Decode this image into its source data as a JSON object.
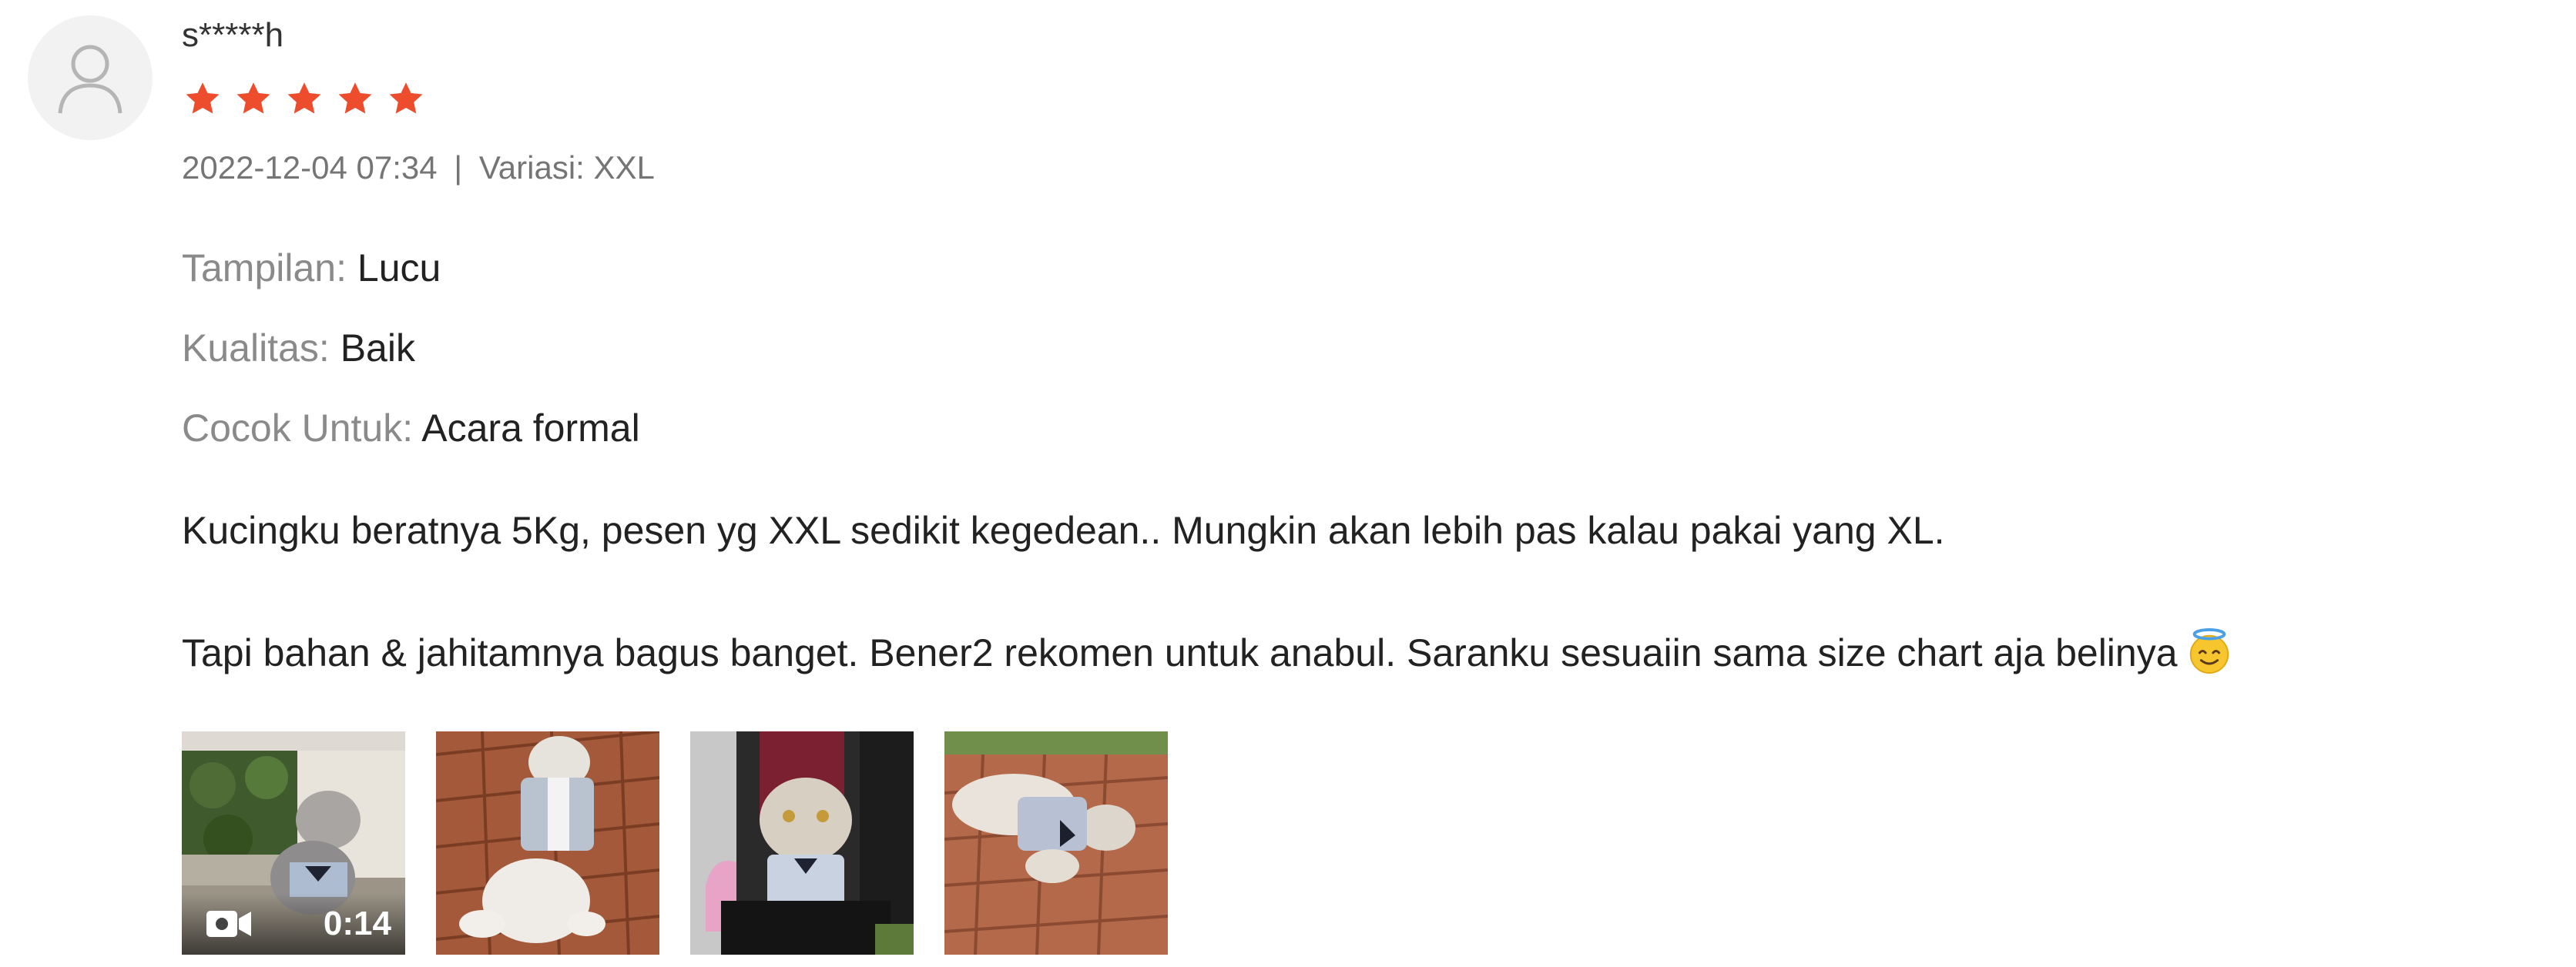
{
  "review": {
    "username": "s*****h",
    "rating": 5,
    "max_rating": 5,
    "star_color": "#ee4d2d",
    "date": "2022-12-04 07:34",
    "separator": "|",
    "variation_label": "Variasi:",
    "variation_value": "XXL",
    "attributes": [
      {
        "label": "Tampilan:",
        "value": "Lucu"
      },
      {
        "label": "Kualitas:",
        "value": "Baik"
      },
      {
        "label": "Cocok Untuk:",
        "value": "Acara formal"
      }
    ],
    "comment_lines": [
      "Kucingku beratnya 5Kg, pesen yg XXL sedikit kegedean.. Mungkin akan lebih pas kalau pakai yang XL.",
      "Tapi bahan & jahitamnya bagus banget. Bener2 rekomen untuk anabul. Saranku sesuaiin sama size chart aja belinya"
    ],
    "comment_emoji": "smiling-face-with-halo",
    "media": [
      {
        "type": "video",
        "duration": "0:14",
        "icon": "video-camera-icon"
      },
      {
        "type": "image"
      },
      {
        "type": "image"
      },
      {
        "type": "image"
      }
    ]
  }
}
